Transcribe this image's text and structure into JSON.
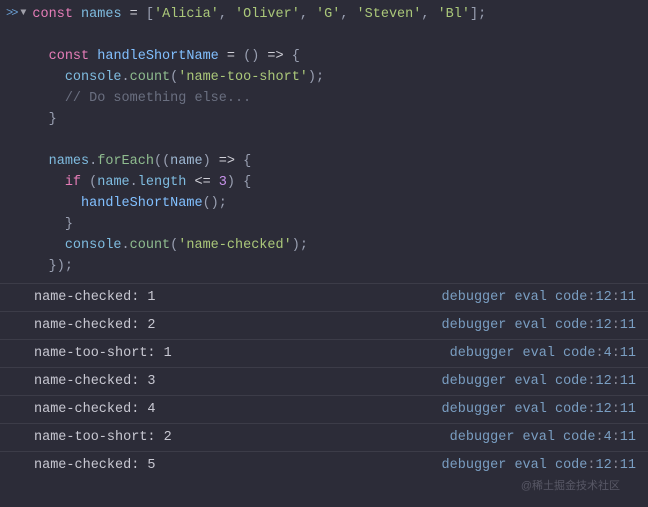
{
  "code": {
    "names_decl": {
      "kw": "const",
      "id": "names",
      "eq": "=",
      "arr": [
        "'Alicia'",
        "'Oliver'",
        "'G'",
        "'Steven'",
        "'Bl'"
      ]
    },
    "fn_decl": {
      "kw": "const",
      "id": "handleShortName",
      "eq": "=",
      "params": "()",
      "arrow": "=>"
    },
    "count1": {
      "obj": "console",
      "m": "count",
      "arg": "'name-too-short'"
    },
    "comment": "// Do something else...",
    "foreach": {
      "obj": "names",
      "m": "forEach",
      "param": "name",
      "arrow": "=>"
    },
    "ifline": {
      "kw": "if",
      "id": "name",
      "prop": "length",
      "op": "<=",
      "num": "3"
    },
    "call": {
      "id": "handleShortName"
    },
    "count2": {
      "obj": "console",
      "m": "count",
      "arg": "'name-checked'"
    }
  },
  "logs": [
    {
      "msg": "name-checked: 1",
      "src": "debugger eval code",
      "line": "12",
      "col": "11"
    },
    {
      "msg": "name-checked: 2",
      "src": "debugger eval code",
      "line": "12",
      "col": "11"
    },
    {
      "msg": "name-too-short: 1",
      "src": "debugger eval code",
      "line": "4",
      "col": "11"
    },
    {
      "msg": "name-checked: 3",
      "src": "debugger eval code",
      "line": "12",
      "col": "11"
    },
    {
      "msg": "name-checked: 4",
      "src": "debugger eval code",
      "line": "12",
      "col": "11"
    },
    {
      "msg": "name-too-short: 2",
      "src": "debugger eval code",
      "line": "4",
      "col": "11"
    },
    {
      "msg": "name-checked: 5",
      "src": "debugger eval code",
      "line": "12",
      "col": "11"
    }
  ],
  "watermark": "@稀土掘金技术社区"
}
